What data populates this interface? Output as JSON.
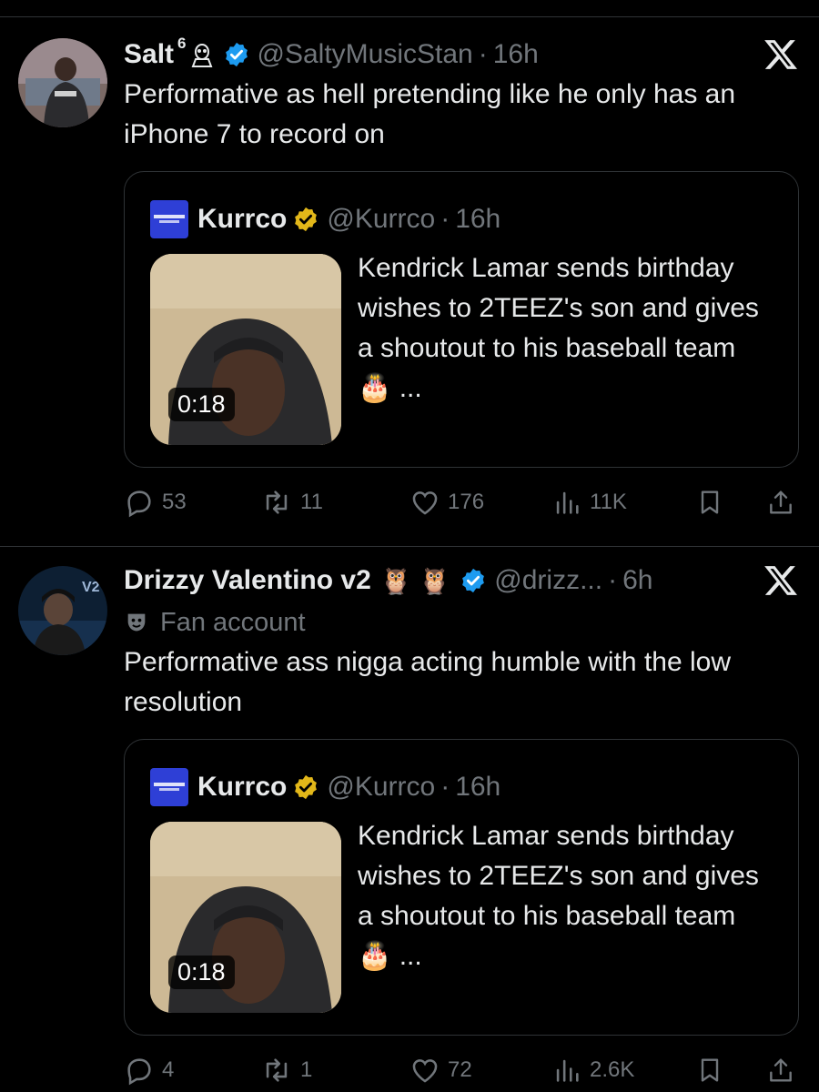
{
  "colors": {
    "background": "#000000",
    "text": "#e7e9ea",
    "muted": "#71767b",
    "verified_blue": "#1d9bf0",
    "verified_gold": "#e2b719",
    "border": "#2f3336"
  },
  "tweets": [
    {
      "name": "Salt",
      "name_sup": "6",
      "handle": "@SaltyMusicStan",
      "sep": "·",
      "time": "16h",
      "text": "Performative as hell pretending like he only has an iPhone 7 to record on",
      "quote": {
        "name": "Kurrco",
        "handle": "@Kurrco",
        "sep": "·",
        "time": "16h",
        "duration": "0:18",
        "text": "Kendrick Lamar sends birthday wishes to 2TEEZ's son and gives a shoutout to his baseball team 🎂 ..."
      },
      "actions": {
        "replies": "53",
        "reposts": "11",
        "likes": "176",
        "views": "11K"
      }
    },
    {
      "name": "Drizzy Valentino v2",
      "name_emoji": "🦉 🦉",
      "handle": "@drizz...",
      "sep": "·",
      "time": "6h",
      "label": "Fan account",
      "text": "Performative ass nigga acting humble with the low resolution",
      "quote": {
        "name": "Kurrco",
        "handle": "@Kurrco",
        "sep": "·",
        "time": "16h",
        "duration": "0:18",
        "text": "Kendrick Lamar sends birthday wishes to 2TEEZ's son and gives a shoutout to his baseball team 🎂 ..."
      },
      "actions": {
        "replies": "4",
        "reposts": "1",
        "likes": "72",
        "views": "2.6K"
      }
    }
  ],
  "icons": [
    "verified-badge-icon",
    "x-logo-icon",
    "reply-icon",
    "repost-icon",
    "like-icon",
    "views-icon",
    "bookmark-icon",
    "share-icon",
    "theater-mask-icon",
    "owl-emoji-icon"
  ]
}
